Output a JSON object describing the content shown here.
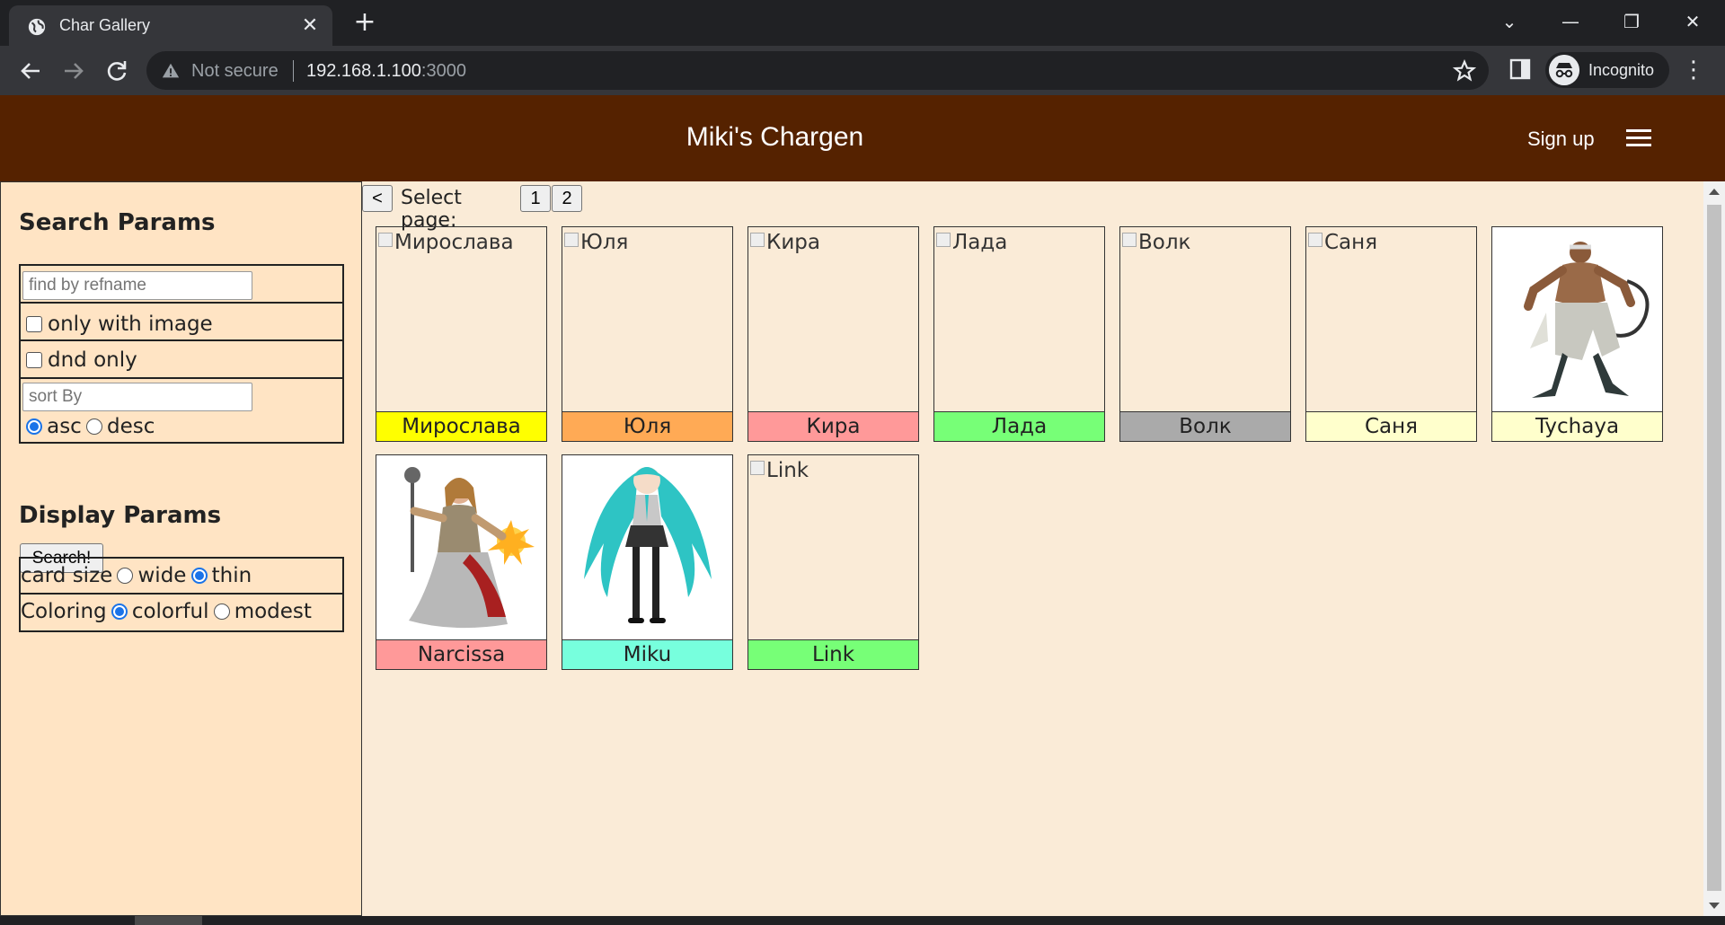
{
  "browser": {
    "tab_title": "Char Gallery",
    "security_label": "Not secure",
    "url_host": "192.168.1.100",
    "url_port": ":3000",
    "profile_label": "Incognito"
  },
  "app": {
    "title": "Miki's Chargen",
    "signup_label": "Sign up"
  },
  "search_params": {
    "heading": "Search Params",
    "refname_placeholder": "find by refname",
    "only_with_image_label": "only with image",
    "dnd_only_label": "dnd only",
    "sort_placeholder": "sort By",
    "asc_label": "asc",
    "desc_label": "desc",
    "search_button": "Search!"
  },
  "display_params": {
    "heading": "Display Params",
    "card_size_label": "card size",
    "wide_label": "wide",
    "thin_label": "thin",
    "coloring_label": "Coloring",
    "colorful_label": "colorful",
    "modest_label": "modest"
  },
  "pager": {
    "prev_label": "<",
    "select_label": "Select page:",
    "pages": [
      "1",
      "2"
    ]
  },
  "cards": [
    {
      "name": "Мирослава",
      "alt": "Мирослава",
      "color": "#ffff00",
      "has_image": false
    },
    {
      "name": "Юля",
      "alt": "Юля",
      "color": "#ffaa55",
      "has_image": false
    },
    {
      "name": "Кира",
      "alt": "Кира",
      "color": "#ff9999",
      "has_image": false
    },
    {
      "name": "Лада",
      "alt": "Лада",
      "color": "#77ff77",
      "has_image": false
    },
    {
      "name": "Волк",
      "alt": "Волк",
      "color": "#aaaaaa",
      "has_image": false
    },
    {
      "name": "Саня",
      "alt": "Саня",
      "color": "#ffffcc",
      "has_image": false
    },
    {
      "name": "Tychaya",
      "alt": "",
      "color": "#ffffcc",
      "has_image": true,
      "image": "monk-fighter-figure"
    },
    {
      "name": "Narcissa",
      "alt": "",
      "color": "#ff9999",
      "has_image": true,
      "image": "warrior-woman-with-mace-figure"
    },
    {
      "name": "Miku",
      "alt": "",
      "color": "#77ffdd",
      "has_image": true,
      "image": "twin-tails-anime-girl-figure"
    },
    {
      "name": "Link",
      "alt": "Link",
      "color": "#77ff77",
      "has_image": false
    }
  ]
}
